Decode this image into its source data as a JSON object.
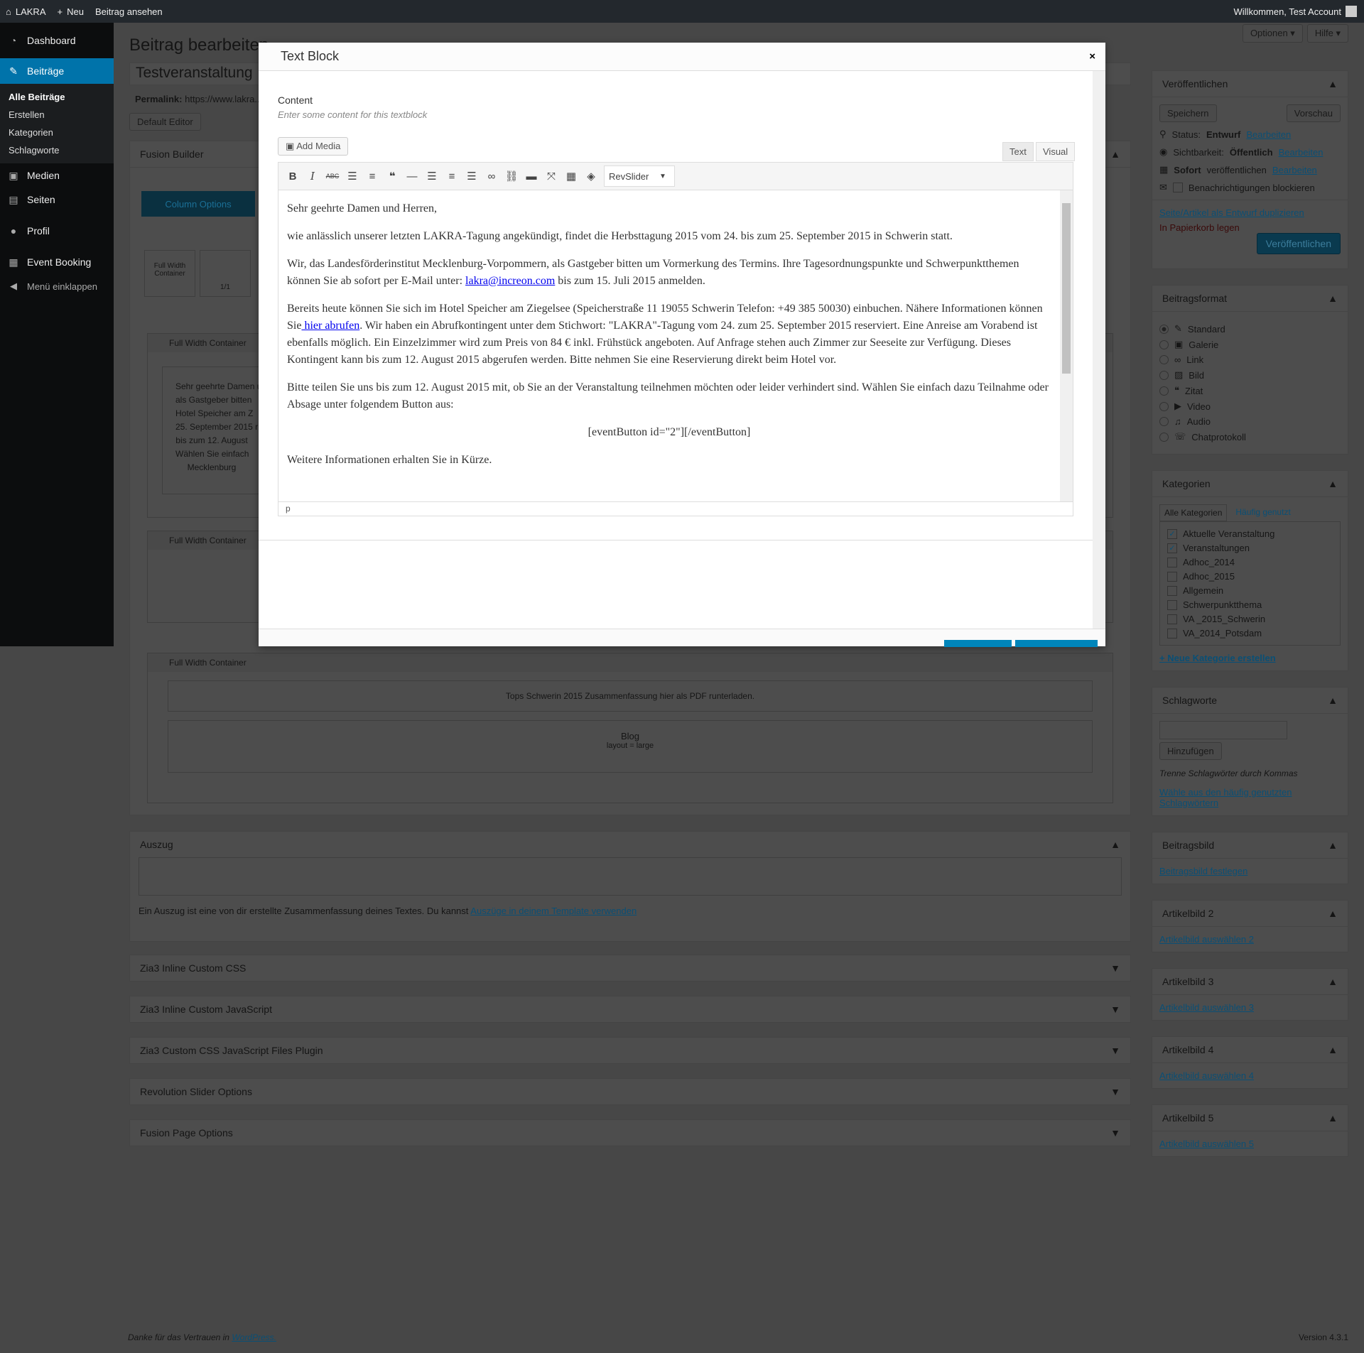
{
  "adminbar": {
    "site": "LAKRA",
    "new": "Neu",
    "view": "Beitrag ansehen",
    "welcome": "Willkommen, Test Account"
  },
  "screen": {
    "options": "Optionen ▾",
    "help": "Hilfe ▾"
  },
  "sidebar": {
    "dashboard": "Dashboard",
    "posts": "Beiträge",
    "sub": [
      "Alle Beiträge",
      "Erstellen",
      "Kategorien",
      "Schlagworte"
    ],
    "media": "Medien",
    "pages": "Seiten",
    "profile": "Profil",
    "booking": "Event Booking",
    "collapse": "Menü einklappen"
  },
  "main": {
    "heading": "Beitrag bearbeiten",
    "title": "Testveranstaltung",
    "permalink_label": "Permalink:",
    "permalink": "https://www.lakra...",
    "default_editor": "Default Editor",
    "builder": "Fusion Builder",
    "column_options": "Column Options",
    "fw": "Full Width Container",
    "one": "1/1",
    "container": "Full Width Container",
    "preview_lines": [
      "Sehr geehrte Damen und Herren,",
      "als Gastgeber bitten",
      "Hotel Speicher am Z",
      "25. September 2015 r",
      "bis zum 12. August",
      "Wählen Sie einfach",
      "Mecklenburg"
    ],
    "pdf_text": "Tops Schwerin 2015 Zusammenfassung hier als PDF runterladen.",
    "blog": "Blog",
    "blog_layout": "layout = large",
    "excerpt": "Auszug",
    "excerpt_help": "Ein Auszug ist eine von dir erstellte Zusammenfassung deines Textes. Du kannst ",
    "excerpt_link": "Auszüge in deinem Template verwenden",
    "boxes": [
      "Zia3 Inline Custom CSS",
      "Zia3 Inline Custom JavaScript",
      "Zia3 Custom CSS JavaScript Files Plugin",
      "Revolution Slider Options",
      "Fusion Page Options"
    ],
    "footer": "Danke für das Vertrauen in ",
    "footer_link": "WordPress.",
    "version": "Version 4.3.1"
  },
  "publish": {
    "title": "Veröffentlichen",
    "save": "Speichern",
    "preview": "Vorschau",
    "status": "Status: ",
    "status_val": "Entwurf",
    "edit": "Bearbeiten",
    "visibility": "Sichtbarkeit: ",
    "visibility_val": "Öffentlich",
    "sofort": "Sofort",
    "publish_when": " veröffentlichen ",
    "block": "Benachrichtigungen blockieren",
    "duplicate": "Seite/Artikel als Entwurf duplizieren",
    "trash": "In Papierkorb legen",
    "publish_btn": "Veröffentlichen"
  },
  "format": {
    "title": "Beitragsformat",
    "options": [
      "Standard",
      "Galerie",
      "Link",
      "Bild",
      "Zitat",
      "Video",
      "Audio",
      "Chatprotokoll"
    ],
    "selected": "Standard"
  },
  "categories": {
    "title": "Kategorien",
    "tab_all": "Alle Kategorien",
    "tab_popular": "Häufig genutzt",
    "items": [
      {
        "label": "Aktuelle Veranstaltung",
        "checked": true
      },
      {
        "label": "Veranstaltungen",
        "checked": true
      },
      {
        "label": "Adhoc_2014",
        "checked": false
      },
      {
        "label": "Adhoc_2015",
        "checked": false
      },
      {
        "label": "Allgemein",
        "checked": false
      },
      {
        "label": "Schwerpunktthema",
        "checked": false
      },
      {
        "label": "VA _2015_Schwerin",
        "checked": false
      },
      {
        "label": "VA_2014_Potsdam",
        "checked": false
      }
    ],
    "new": "+ Neue Kategorie erstellen"
  },
  "tags": {
    "title": "Schlagworte",
    "add": "Hinzufügen",
    "help": "Trenne Schlagwörter durch Kommas",
    "choose": "Wähle aus den häufig genutzten Schlagwörtern"
  },
  "featured": [
    {
      "title": "Beitragsbild",
      "link": "Beitragsbild festlegen"
    },
    {
      "title": "Artikelbild 2",
      "link": "Artikelbild auswählen 2"
    },
    {
      "title": "Artikelbild 3",
      "link": "Artikelbild auswählen 3"
    },
    {
      "title": "Artikelbild 4",
      "link": "Artikelbild auswählen 4"
    },
    {
      "title": "Artikelbild 5",
      "link": "Artikelbild auswählen 5"
    }
  ],
  "modal": {
    "title": "Text Block",
    "close": "×",
    "content_label": "Content",
    "content_desc": "Enter some content for this textblock",
    "add_media": "Add Media",
    "tab_text": "Text",
    "tab_visual": "Visual",
    "revslider": "RevSlider",
    "status_path": "p",
    "body": {
      "p1": "Sehr geehrte Damen und Herren,",
      "p2": "wie anlässlich unserer letzten LAKRA-Tagung angekündigt, findet die Herbsttagung 2015 vom 24. bis zum 25. September 2015 in Schwerin statt.",
      "p3a": "Wir, das Landesförderinstitut Mecklenburg-Vorpommern, als Gastgeber bitten um Vormerkung des Termins. Ihre Tagesordnungspunkte und Schwerpunktthemen können Sie ab sofort per E-Mail unter: ",
      "email": "lakra@increon.com",
      "p3b": " bis zum 15. Juli 2015 anmelden.",
      "p4a": "Bereits heute können Sie sich im Hotel Speicher am Ziegelsee (Speicherstraße 11 19055 Schwerin Telefon: +49 385 50030) einbuchen. Nähere Informationen können Sie",
      "link": " hier abrufen",
      "p4b": ". Wir haben ein Abrufkontingent unter dem Stichwort: \"LAKRA\"-Tagung vom 24. zum 25. September 2015 reserviert. Eine Anreise am Vorabend ist ebenfalls möglich. Ein Einzelzimmer wird  zum Preis von 84 € inkl. Frühstück angeboten. Auf Anfrage stehen auch Zimmer zur Seeseite zur Verfügung. Dieses Kontingent kann bis zum 12. August 2015 abgerufen werden. Bitte nehmen Sie eine Reservierung direkt beim Hotel vor.",
      "p5": "Bitte teilen Sie uns bis zum 12. August 2015 mit, ob Sie an der Veranstaltung teilnehmen möchten oder leider verhindert sind. Wählen Sie einfach dazu Teilnahme oder Absage unter folgendem Button aus:",
      "p6": "[eventButton id=\"2\"][/eventButton]",
      "p7": "Weitere Informationen erhalten Sie in Kürze."
    }
  },
  "colors": {
    "accent": "#0073aa",
    "adminbar": "#23282d",
    "modal_button": "#0085ba"
  }
}
